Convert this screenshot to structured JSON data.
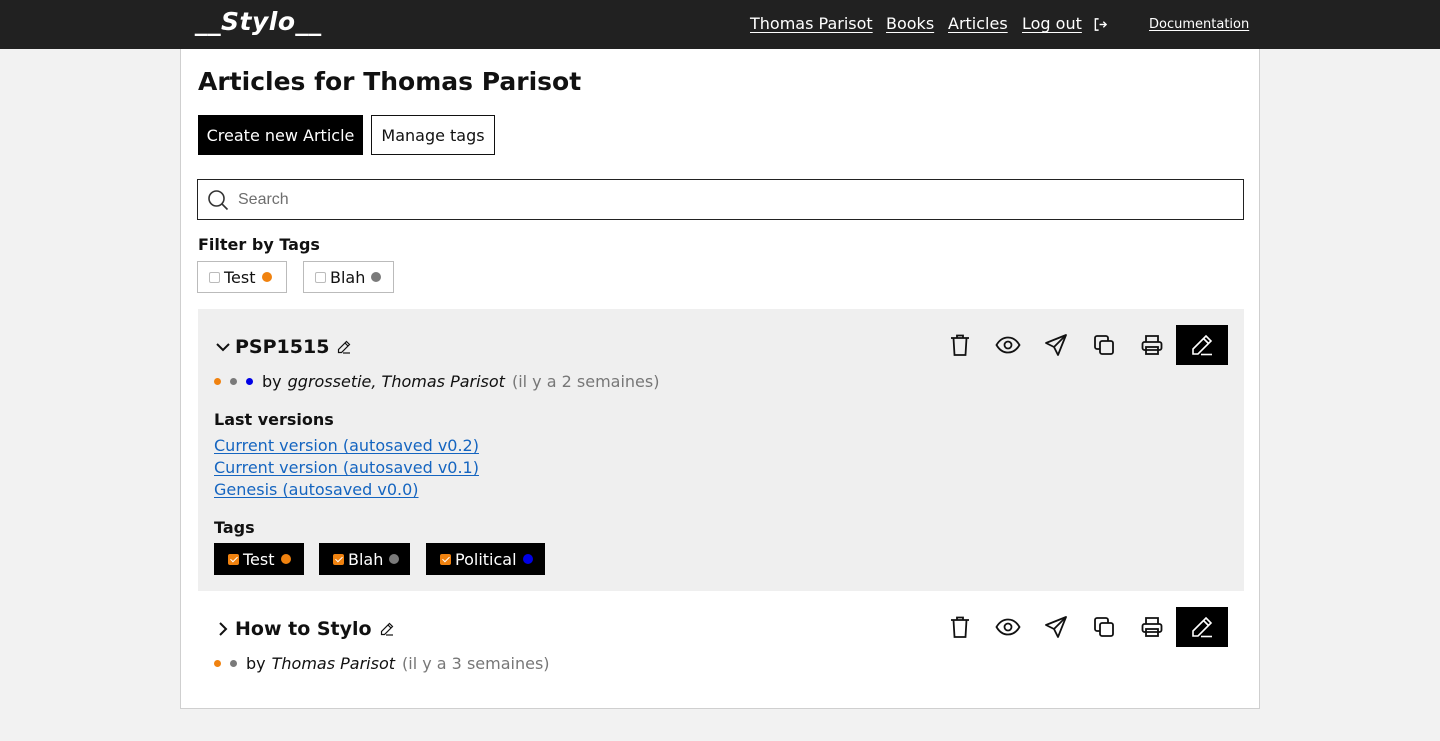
{
  "app": {
    "logo": "__Stylo__"
  },
  "nav": {
    "user": "Thomas Parisot",
    "books": "Books",
    "articles": "Articles",
    "logout": "Log out",
    "documentation": "Documentation"
  },
  "page": {
    "title": "Articles for Thomas Parisot",
    "create_button": "Create new Article",
    "manage_tags_button": "Manage tags",
    "search_placeholder": "Search",
    "search_value": "",
    "filter_title": "Filter by Tags"
  },
  "filter_tags": [
    {
      "label": "Test",
      "checked": false,
      "color": "#f0820f"
    },
    {
      "label": "Blah",
      "checked": false,
      "color": "#7a7a7a"
    }
  ],
  "colors": {
    "orange": "#f0820f",
    "gray": "#7a7a7a",
    "blue": "#0000e6",
    "link": "#1565c0",
    "topbar": "#212121"
  },
  "articles": [
    {
      "title": "PSP1515",
      "expanded": true,
      "by": "by",
      "authors": "ggrossetie, Thomas Parisot",
      "when": "(il y a 2 semaines)",
      "tag_dots": [
        "#f0820f",
        "#7a7a7a",
        "#0000e6"
      ],
      "versions_label": "Last versions",
      "versions": [
        "Current version (autosaved v0.2)",
        "Current version (autosaved v0.1)",
        "Genesis (autosaved v0.0)"
      ],
      "tags_label": "Tags",
      "tags": [
        {
          "label": "Test",
          "checked": true,
          "color": "#f0820f"
        },
        {
          "label": "Blah",
          "checked": true,
          "color": "#7a7a7a"
        },
        {
          "label": "Political",
          "checked": true,
          "color": "#0000e6"
        }
      ]
    },
    {
      "title": "How to Stylo",
      "expanded": false,
      "by": "by",
      "authors": "Thomas Parisot",
      "when": "(il y a 3 semaines)",
      "tag_dots": [
        "#f0820f",
        "#7a7a7a"
      ]
    }
  ],
  "action_icons": [
    "trash-icon",
    "eye-icon",
    "send-icon",
    "copy-icon",
    "printer-icon",
    "pencil-icon"
  ]
}
